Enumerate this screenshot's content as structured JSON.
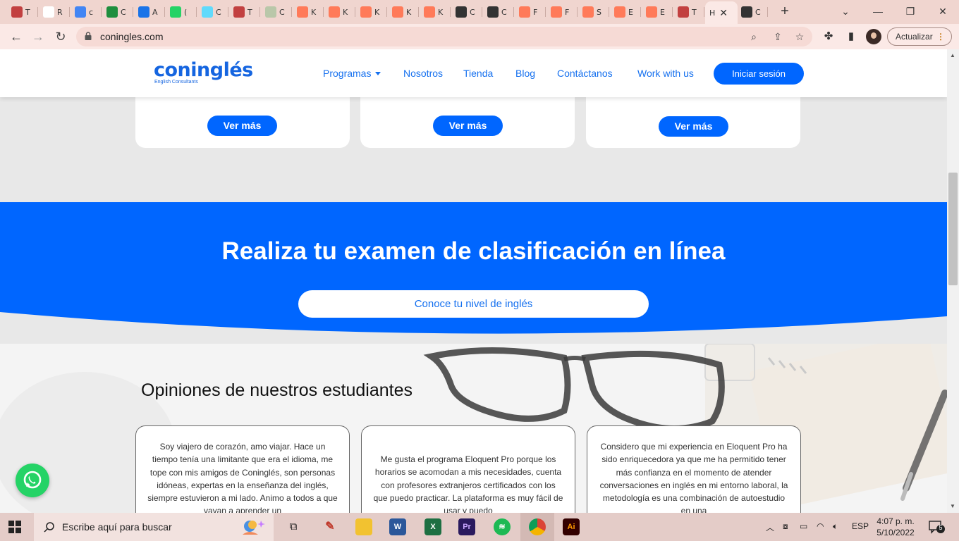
{
  "browser": {
    "tabs": [
      {
        "letter": "T",
        "icon": "doc-icon",
        "color": "#c24040"
      },
      {
        "letter": "R",
        "icon": "gmail-icon",
        "color": "#ffffff"
      },
      {
        "letter": "c",
        "icon": "calendar-icon",
        "color": "#4285f4"
      },
      {
        "letter": "C",
        "icon": "plus-icon",
        "color": "#1e8e3e"
      },
      {
        "letter": "A",
        "icon": "c-logo-icon",
        "color": "#1a73e8"
      },
      {
        "letter": "(",
        "icon": "whatsapp-icon",
        "color": "#25d366"
      },
      {
        "letter": "C",
        "icon": "react-icon",
        "color": "#61dafb"
      },
      {
        "letter": "T",
        "icon": "doc-icon",
        "color": "#c24040"
      },
      {
        "letter": "C",
        "icon": "wa-icon",
        "color": "#b9c7a9"
      },
      {
        "letter": "K",
        "icon": "hubspot-icon",
        "color": "#ff7a59"
      },
      {
        "letter": "K",
        "icon": "hubspot-icon",
        "color": "#ff7a59"
      },
      {
        "letter": "K",
        "icon": "hubspot-icon",
        "color": "#ff7a59"
      },
      {
        "letter": "K",
        "icon": "hubspot-icon",
        "color": "#ff7a59"
      },
      {
        "letter": "K",
        "icon": "hubspot-icon",
        "color": "#ff7a59"
      },
      {
        "letter": "C",
        "icon": "globe-icon",
        "color": "#333333"
      },
      {
        "letter": "C",
        "icon": "globe-icon",
        "color": "#333333"
      },
      {
        "letter": "F",
        "icon": "hubspot-icon",
        "color": "#ff7a59"
      },
      {
        "letter": "F",
        "icon": "hubspot-icon",
        "color": "#ff7a59"
      },
      {
        "letter": "S",
        "icon": "hubspot-icon",
        "color": "#ff7a59"
      },
      {
        "letter": "E",
        "icon": "hubspot-icon",
        "color": "#ff7a59"
      },
      {
        "letter": "E",
        "icon": "hubspot-icon",
        "color": "#ff7a59"
      },
      {
        "letter": "T",
        "icon": "doc-icon",
        "color": "#c24040"
      },
      {
        "letter": "H",
        "icon": "",
        "color": ""
      },
      {
        "letter": "C",
        "icon": "globe-icon",
        "color": "#333333"
      }
    ],
    "new_tab": "+",
    "url": "coningles.com",
    "update_label": "Actualizar"
  },
  "site": {
    "logo": "coninglés",
    "logo_tagline": "English Consultants",
    "nav": [
      "Programas",
      "Nosotros",
      "Tienda",
      "Blog",
      "Contáctanos",
      "Work with us"
    ],
    "login": "Iniciar sesión",
    "cards": [
      {
        "button": "Ver más"
      },
      {
        "button": "Ver más"
      },
      {
        "button": "Ver más"
      }
    ],
    "band_title": "Realiza tu examen de clasificación en línea",
    "band_button": "Conoce tu nivel de inglés",
    "testimonials_title": "Opiniones de nuestros estudiantes",
    "testimonials": [
      "Soy viajero de corazón, amo viajar. Hace un tiempo tenía una limitante que era el idioma, me tope con mis amigos de Coninglés, son personas idóneas, expertas en la enseñanza del inglés, siempre estuvieron a mi lado. Animo a todos a que vayan a aprender un",
      "Me gusta el programa Eloquent Pro porque los horarios se acomodan a mis necesidades, cuenta con profesores extranjeros certificados con los que puedo practicar. La plataforma es muy fácil de usar y puedo",
      "Considero que mi experiencia en Eloquent Pro ha sido enriquecedora ya que me ha permitido tener más confianza en el momento de atender conversaciones en inglés en mi entorno laboral, la metodología es una combinación de autoestudio en una"
    ],
    "colors": {
      "brand_blue": "#0066ff",
      "whatsapp": "#25d366"
    }
  },
  "taskbar": {
    "search_placeholder": "Escribe aquí para buscar",
    "language": "ESP",
    "time": "4:07 p. m.",
    "date": "5/10/2022",
    "notifications": "5",
    "apps": [
      "task-view-icon",
      "paint-icon",
      "file-explorer-icon",
      "word-icon",
      "excel-icon",
      "premiere-icon",
      "spotify-icon",
      "chrome-icon",
      "illustrator-icon"
    ]
  }
}
